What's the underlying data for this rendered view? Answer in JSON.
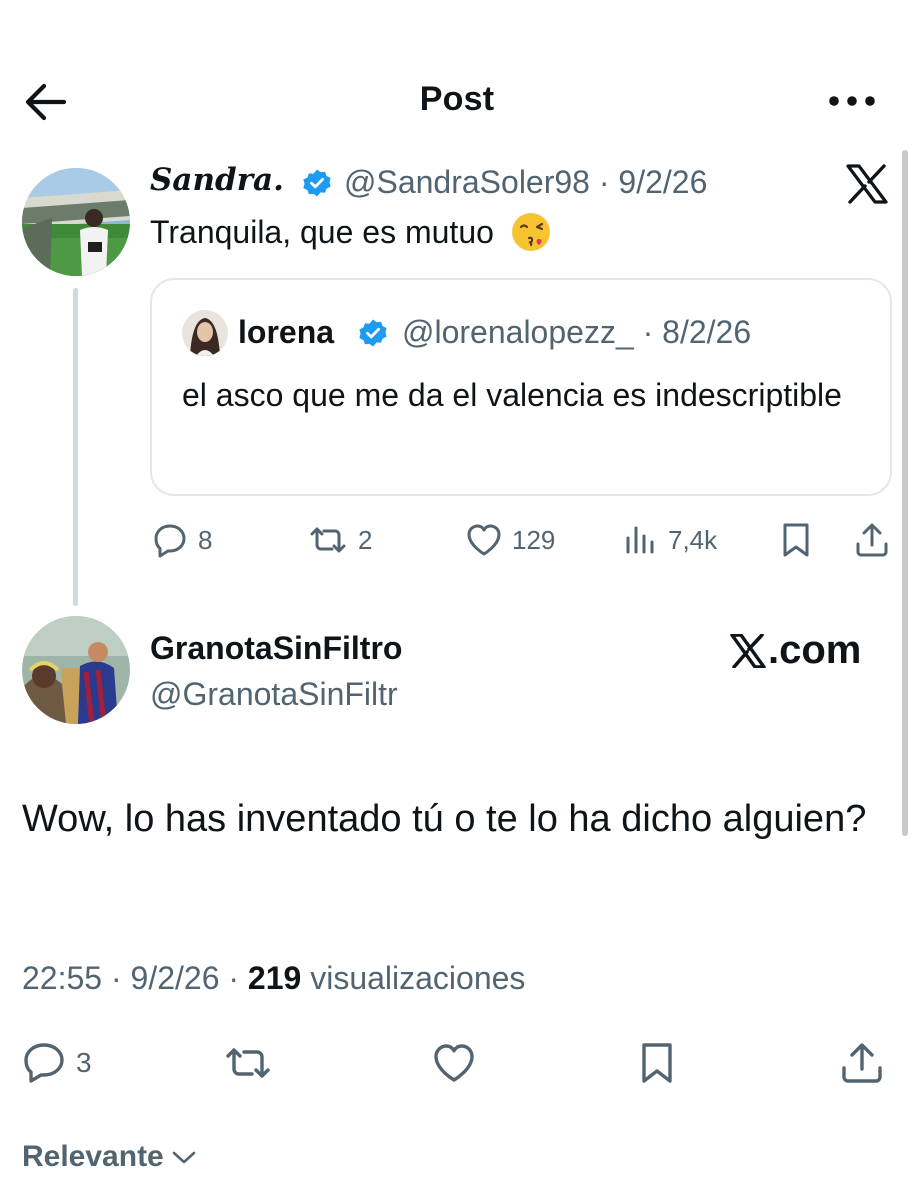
{
  "header": {
    "title": "Post",
    "back_icon": "arrow-left-icon",
    "more_icon": "more-horizontal-icon"
  },
  "quoted_post": {
    "author_name": "Sandra.",
    "handle": "@SandraSoler98",
    "date": "9/2/26",
    "text": "Tranquila, que es mutuo",
    "emoji": "face-blowing-kiss-icon",
    "quote": {
      "author_name": "lorena",
      "handle": "@lorenalopezz_",
      "date": "8/2/26",
      "text": "el asco que me da el valencia es indescriptible"
    },
    "actions": {
      "replies": "8",
      "reposts": "2",
      "likes": "129",
      "views": "7,4k"
    }
  },
  "reply_post": {
    "author_name": "GranotaSinFiltro",
    "handle": "@GranotaSinFiltr",
    "watermark": ".com",
    "text": "Wow, lo has inventado tú o te lo ha dicho alguien?",
    "time": "22:55",
    "date": "9/2/26",
    "views_count": "219",
    "views_label": "visualizaciones",
    "actions": {
      "replies": "3"
    }
  },
  "footer": {
    "sort_label": "Relevante"
  },
  "colors": {
    "text": "#0f1419",
    "secondary": "#536471",
    "verified": "#1d9bf0",
    "border": "#e1e8ed"
  }
}
